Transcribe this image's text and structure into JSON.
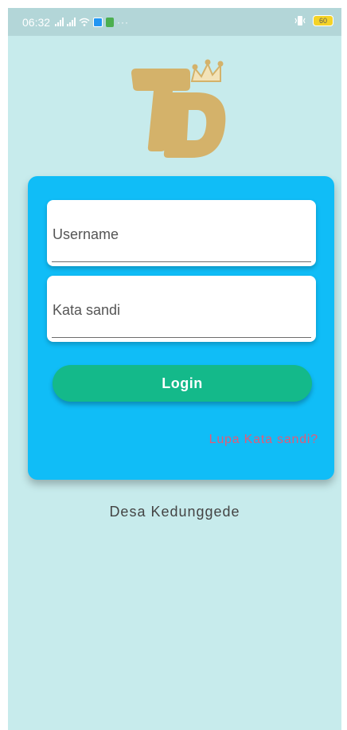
{
  "status_bar": {
    "time": "06:32",
    "battery": "60",
    "overflow_dots": "···"
  },
  "logo": {
    "text": "TD"
  },
  "login_form": {
    "username_placeholder": "Username",
    "password_placeholder": "Kata sandi",
    "login_label": "Login",
    "forgot_label": "Lupa Kata sandi?"
  },
  "footer": {
    "text": "Desa Kedunggede"
  },
  "colors": {
    "background": "#c7ebec",
    "card": "#10bdf7",
    "login_button": "#14b98a",
    "forgot_link": "#e25b78",
    "logo_gold": "#d4b26a"
  }
}
